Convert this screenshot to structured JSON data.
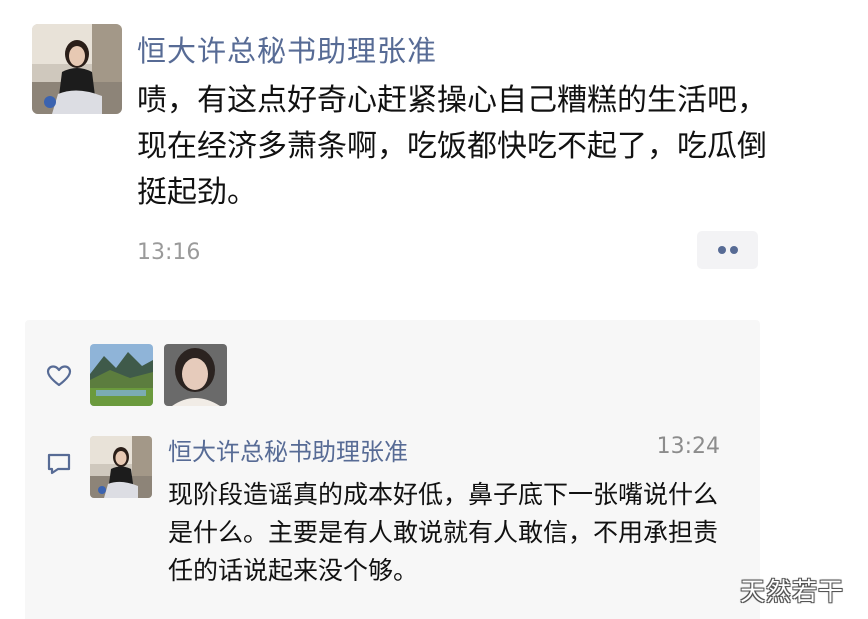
{
  "post": {
    "author": "恒大许总秘书助理张准",
    "text": "啧，有这点好奇心赶紧操心自己糟糕的生活吧，现在经济多萧条啊，吃饭都快吃不起了，吃瓜倒挺起劲。",
    "time": "13:16",
    "more_icon": "more-dots-icon"
  },
  "likes": {
    "icon": "heart-outline-icon",
    "likers": [
      "landscape-avatar",
      "woman-portrait-avatar"
    ]
  },
  "comments": [
    {
      "icon": "comment-bubble-icon",
      "author": "恒大许总秘书助理张准",
      "time": "13:24",
      "text": "现阶段造谣真的成本好低，鼻子底下一张嘴说什么是什么。主要是有人敢说就有人敢信，不用承担责任的话说起来没个够。"
    }
  ],
  "watermark": "天然若干",
  "colors": {
    "name_link": "#576b95",
    "timestamp": "#9a9a9a",
    "panel_background": "#f7f7f7",
    "text": "#111111"
  }
}
